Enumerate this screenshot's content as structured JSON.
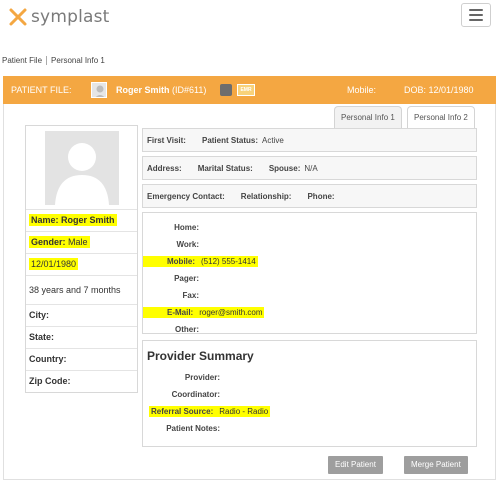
{
  "brand": {
    "name": "symplast",
    "accent": "#f4a742",
    "logo_colors": [
      "#f4a742",
      "#7a7a7a"
    ]
  },
  "breadcrumb": [
    "Patient File",
    "Personal Info 1"
  ],
  "patient_bar": {
    "label": "PATIENT FILE:",
    "name": "Roger Smith",
    "id": "(ID#611)",
    "emr_badge": "EMR",
    "mobile_label": "Mobile:",
    "dob": "DOB:  12/01/1980"
  },
  "tabs": [
    "Personal Info 1",
    "Personal Info 2"
  ],
  "left_card": {
    "name": "Name: Roger Smith",
    "gender_label": "Gender:",
    "gender": "Male",
    "dob": "12/01/1980",
    "age": "38 years and 7 months",
    "city": "City:",
    "state": "State:",
    "country": "Country:",
    "zip": "Zip Code:"
  },
  "visit": {
    "first_visit": "First Visit:",
    "status_label": "Patient Status:",
    "status": "Active"
  },
  "address": {
    "address": "Address:",
    "marital": "Marital Status:",
    "spouse_label": "Spouse:",
    "spouse": "N/A"
  },
  "emergency": {
    "contact": "Emergency Contact:",
    "relationship": "Relationship:",
    "phone": "Phone:"
  },
  "contacts": [
    {
      "label": "Home:",
      "value": ""
    },
    {
      "label": "Work:",
      "value": ""
    },
    {
      "label": "Mobile:",
      "value": "(512) 555-1414"
    },
    {
      "label": "Pager:",
      "value": ""
    },
    {
      "label": "Fax:",
      "value": ""
    },
    {
      "label": "E-Mail:",
      "value": "roger@smith.com"
    },
    {
      "label": "Other:",
      "value": ""
    }
  ],
  "provider_summary": {
    "title": "Provider Summary",
    "rows": [
      {
        "label": "Provider:",
        "value": ""
      },
      {
        "label": "Coordinator:",
        "value": ""
      },
      {
        "label": "Referral Source:",
        "value": "Radio - Radio"
      },
      {
        "label": "Patient Notes:",
        "value": ""
      }
    ]
  },
  "buttons": {
    "edit": "Edit Patient",
    "merge": "Merge Patient"
  }
}
